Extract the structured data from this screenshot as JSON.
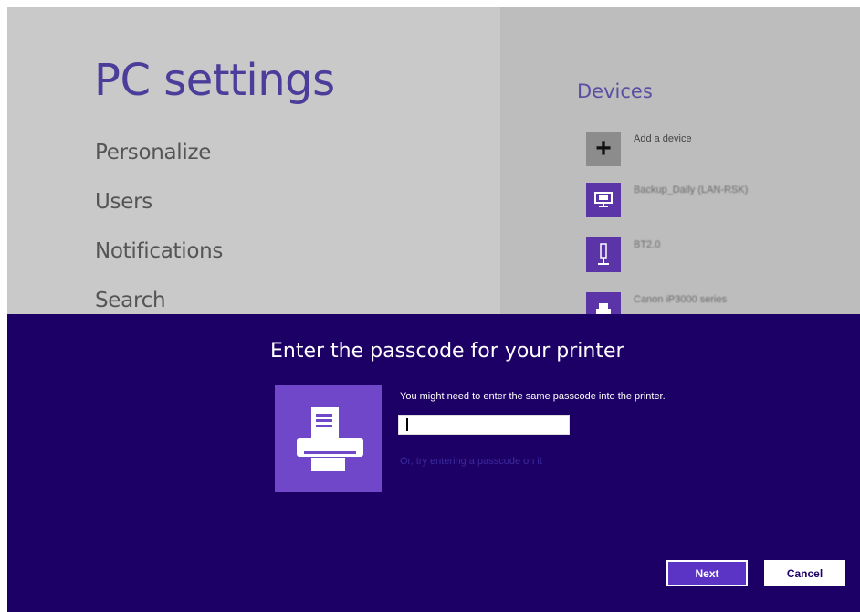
{
  "settings": {
    "title": "PC settings",
    "nav": [
      "Personalize",
      "Users",
      "Notifications",
      "Search"
    ]
  },
  "devices": {
    "title": "Devices",
    "items": [
      {
        "label": "Add a device",
        "icon": "plus-icon"
      },
      {
        "label": "Backup_Daily (LAN-RSK)",
        "icon": "computer-icon"
      },
      {
        "label": "BT2.0",
        "icon": "usb-device-icon"
      },
      {
        "label": "Canon iP3000 series",
        "icon": "printer-icon"
      }
    ]
  },
  "dialog": {
    "title": "Enter the passcode for your printer",
    "message": "You might need to enter the same passcode into the printer.",
    "passcode_value": "",
    "alt_link": "Or, try entering a passcode on it",
    "next_label": "Next",
    "cancel_label": "Cancel",
    "icon": "printer-icon"
  },
  "colors": {
    "dialog_bg": "#1d0066",
    "accent": "#6f47c8",
    "title_purple": "#4b3d9a"
  }
}
